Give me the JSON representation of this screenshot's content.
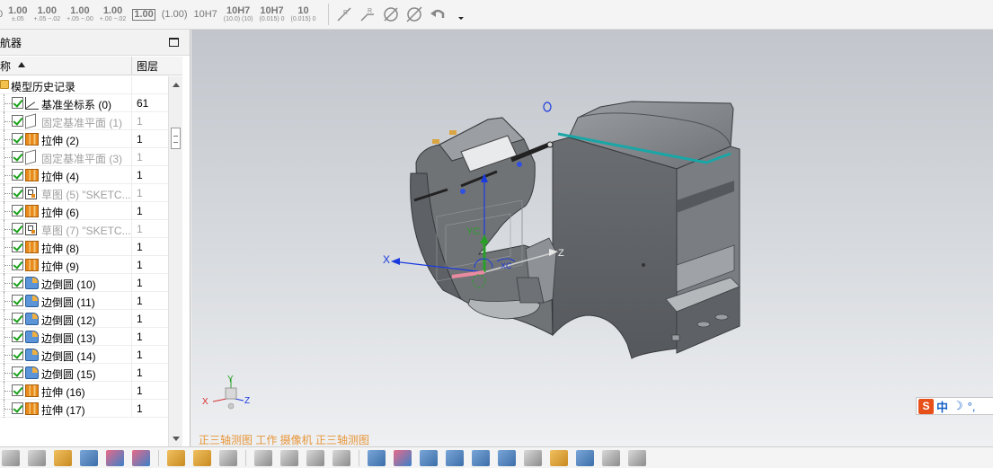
{
  "toolbar": {
    "tolerances": [
      {
        "big": "1.00",
        "small": "±.05",
        "style": "stack"
      },
      {
        "big": "1.00",
        "small": "+.05 −.02",
        "style": "stack"
      },
      {
        "big": "1.00",
        "small": "+.05 −.00",
        "style": "stack"
      },
      {
        "big": "1.00",
        "small": "+.00 −.02",
        "style": "stack"
      },
      {
        "big": "1.00",
        "small": "",
        "style": "boxed"
      },
      {
        "big": "(1.00)",
        "small": "",
        "style": "paren"
      },
      {
        "big": "10H7",
        "small": "",
        "style": "paren"
      },
      {
        "big": "10H7",
        "small": "(10.0) (10)",
        "style": "stack"
      },
      {
        "big": "10H7",
        "small": "(0.015) 0",
        "style": "stack"
      },
      {
        "big": "10",
        "small": "(0.015) 0",
        "style": "stack"
      }
    ],
    "tool_icons": [
      "radius-dim-icon",
      "radius-dim-alt-icon",
      "no-symbol-icon",
      "no-symbol-alt-icon",
      "undo-arrow-icon",
      "dropdown-arrow-icon"
    ]
  },
  "navigator": {
    "title": "导航器",
    "columns": {
      "name": "名称",
      "layer": "图层"
    },
    "root": "模型历史记录",
    "items": [
      {
        "label": "基准坐标系 (0)",
        "layer": "61",
        "icon": "csys",
        "dim": false
      },
      {
        "label": "固定基准平面 (1)",
        "layer": "1",
        "icon": "plane",
        "dim": true
      },
      {
        "label": "拉伸 (2)",
        "layer": "1",
        "icon": "extrude",
        "dim": false
      },
      {
        "label": "固定基准平面 (3)",
        "layer": "1",
        "icon": "plane",
        "dim": true
      },
      {
        "label": "拉伸 (4)",
        "layer": "1",
        "icon": "extrude",
        "dim": false
      },
      {
        "label": "草图 (5) \"SKETC...",
        "layer": "1",
        "icon": "sketch",
        "dim": true
      },
      {
        "label": "拉伸 (6)",
        "layer": "1",
        "icon": "extrude",
        "dim": false
      },
      {
        "label": "草图 (7) \"SKETC...",
        "layer": "1",
        "icon": "sketch",
        "dim": true
      },
      {
        "label": "拉伸 (8)",
        "layer": "1",
        "icon": "extrude",
        "dim": false
      },
      {
        "label": "拉伸 (9)",
        "layer": "1",
        "icon": "extrude",
        "dim": false
      },
      {
        "label": "边倒圆 (10)",
        "layer": "1",
        "icon": "blend",
        "dim": false
      },
      {
        "label": "边倒圆 (11)",
        "layer": "1",
        "icon": "blend",
        "dim": false
      },
      {
        "label": "边倒圆 (12)",
        "layer": "1",
        "icon": "blend",
        "dim": false
      },
      {
        "label": "边倒圆 (13)",
        "layer": "1",
        "icon": "blend",
        "dim": false
      },
      {
        "label": "边倒圆 (14)",
        "layer": "1",
        "icon": "blend",
        "dim": false
      },
      {
        "label": "边倒圆 (15)",
        "layer": "1",
        "icon": "blend",
        "dim": false
      },
      {
        "label": "拉伸 (16)",
        "layer": "1",
        "icon": "extrude",
        "dim": false
      },
      {
        "label": "拉伸 (17)",
        "layer": "1",
        "icon": "extrude",
        "dim": false
      }
    ]
  },
  "viewport": {
    "view_label": "正三轴测图 工作 摄像机 正三轴测图",
    "axis_labels": {
      "x": "X",
      "y": "YC",
      "z": "Z",
      "xc": "XC",
      "triad_x": "X",
      "triad_y": "Y",
      "triad_z": "Z"
    },
    "ime": {
      "logo": "S",
      "lang": "中",
      "moon": "☽",
      "punct": "°,"
    }
  },
  "colors": {
    "accent_orange": "#e8963a",
    "model_gray": "#6e7073",
    "axis_blue": "#1a3adf",
    "axis_green": "#28a028",
    "axis_red": "#d83030"
  }
}
